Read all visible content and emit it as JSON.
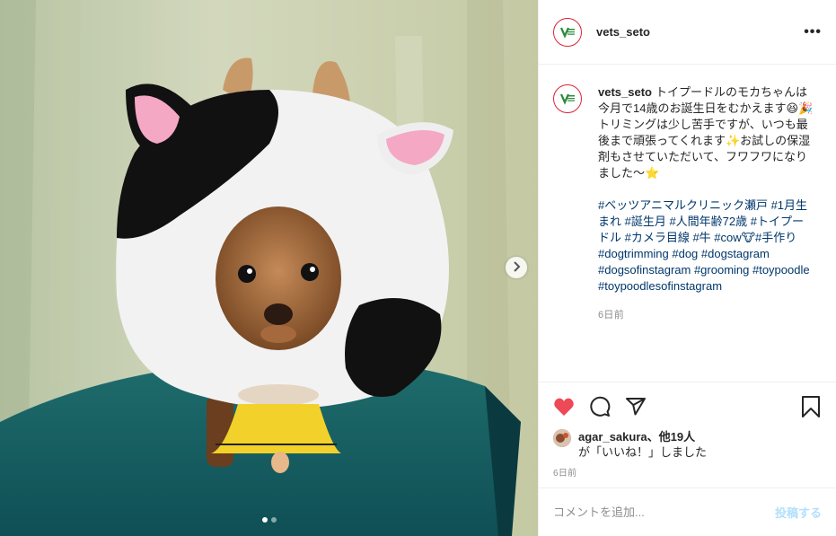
{
  "post": {
    "username": "vets_seto",
    "more_icon": "ellipsis-icon",
    "caption_text": "トイプードルのモカちゃんは今月で14歳のお誕生日をむかえます😆🎉トリミングは少し苦手ですが、いつも最後まで頑張ってくれます✨お試しの保湿剤もさせていただいて、フワフワになりました～⭐",
    "hashtags": "#ベッツアニマルクリニック瀬戸 #1月生まれ #誕生月 #人間年齢72歳 #トイプードル #カメラ目線 #牛 #cow🐮#手作り#dogtrimming #dog #dogstagram #dogsofinstagram #grooming #toypoodle #toypoodlesofinstagram",
    "caption_time": "6日前"
  },
  "media": {
    "slide_count": 2,
    "active_slide": 1,
    "next_icon": "chevron-right-icon"
  },
  "actions": {
    "like_icon": "heart-icon",
    "comment_icon": "comment-icon",
    "share_icon": "paper-plane-icon",
    "save_icon": "bookmark-icon",
    "liked": true,
    "like_color": "#ed4956"
  },
  "likes": {
    "user": "agar_sakura",
    "others": "、他19人",
    "suffix": "が「いいね！」しました"
  },
  "post_time": "6日前",
  "comment_box": {
    "placeholder": "コメントを追加...",
    "post_label": "投稿する"
  },
  "colors": {
    "link": "#00376b",
    "post_button": "#b2dffc",
    "avatar_ring": "#dd2233"
  }
}
